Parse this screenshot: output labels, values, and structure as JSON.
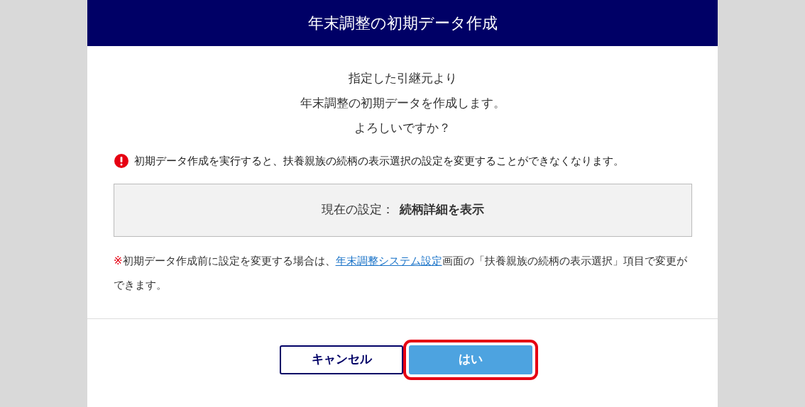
{
  "dialog": {
    "title": "年末調整の初期データ作成",
    "message_lines": [
      "指定した引継元より",
      "年末調整の初期データを作成します。",
      "よろしいですか？"
    ],
    "warning": "初期データ作成を実行すると、扶養親族の続柄の表示選択の設定を変更することができなくなります。",
    "setting": {
      "label": "現在の設定：",
      "value": "続柄詳細を表示"
    },
    "note": {
      "mark": "※",
      "before": "初期データ作成前に設定を変更する場合は、",
      "link": "年末調整システム設定",
      "after": "画面の「扶養親族の続柄の表示選択」項目で変更ができます。"
    },
    "buttons": [
      {
        "label": "キャンセル",
        "kind": "secondary",
        "highlighted": false
      },
      {
        "label": "はい",
        "kind": "primary",
        "highlighted": true
      }
    ]
  }
}
